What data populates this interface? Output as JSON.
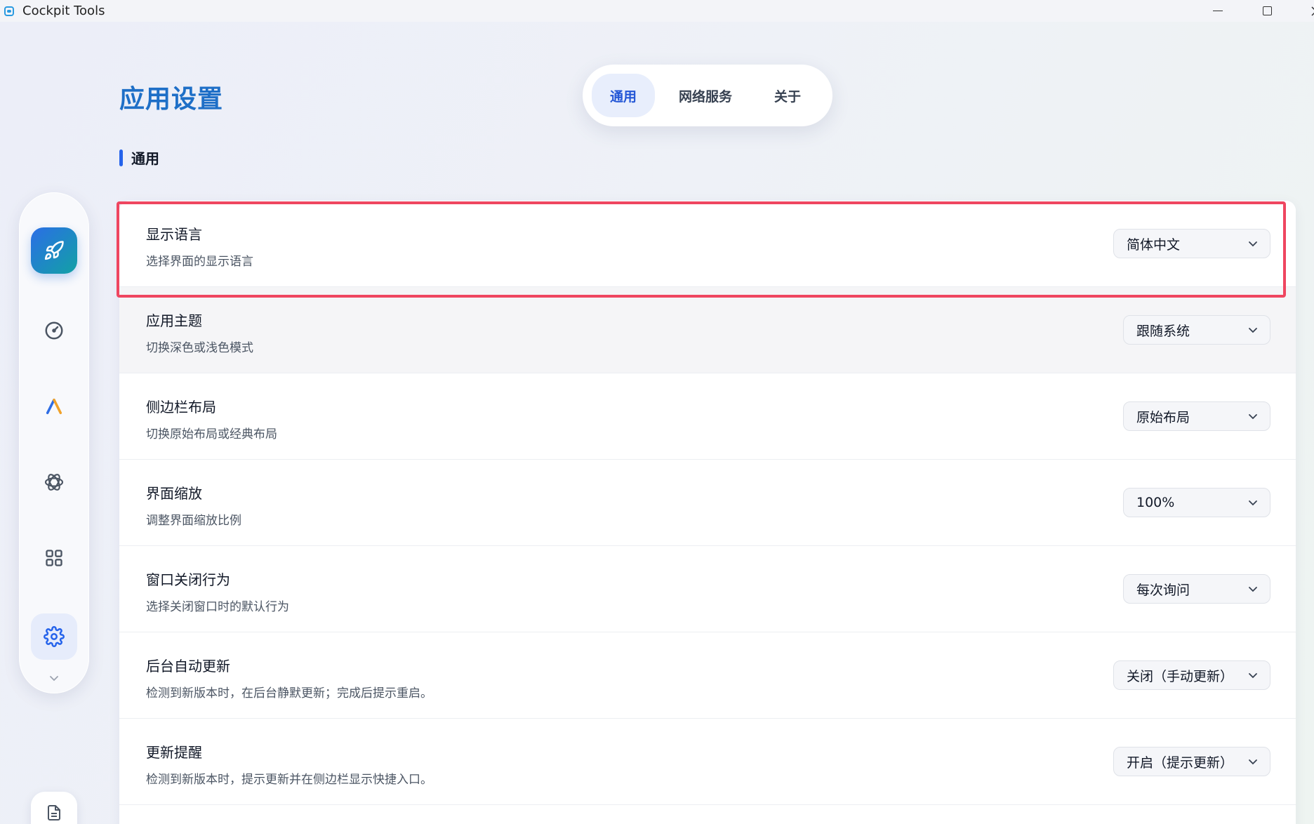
{
  "window": {
    "title": "Cockpit Tools"
  },
  "page": {
    "title": "应用设置",
    "section_title": "通用"
  },
  "tabs": [
    {
      "label": "通用",
      "active": true
    },
    {
      "label": "网络服务",
      "active": false
    },
    {
      "label": "关于",
      "active": false
    }
  ],
  "sidebar": {
    "items": [
      {
        "icon": "rocket-icon",
        "active": true
      },
      {
        "icon": "gauge-icon",
        "active": false
      },
      {
        "icon": "antigravity-logo-icon",
        "active": false
      },
      {
        "icon": "openai-logo-icon",
        "active": false
      },
      {
        "icon": "apps-grid-icon",
        "active": false
      },
      {
        "icon": "gear-icon",
        "active": true
      }
    ],
    "more_icon": "chevron-down-icon",
    "bottom_icon": "document-icon"
  },
  "settings": [
    {
      "label": "显示语言",
      "description": "选择界面的显示语言",
      "value": "简体中文"
    },
    {
      "label": "应用主题",
      "description": "切换深色或浅色模式",
      "value": "跟随系统"
    },
    {
      "label": "侧边栏布局",
      "description": "切换原始布局或经典布局",
      "value": "原始布局"
    },
    {
      "label": "界面缩放",
      "description": "调整界面缩放比例",
      "value": "100%"
    },
    {
      "label": "窗口关闭行为",
      "description": "选择关闭窗口时的默认行为",
      "value": "每次询问"
    },
    {
      "label": "后台自动更新",
      "description": "检测到新版本时，在后台静默更新；完成后提示重启。",
      "value": "关闭（手动更新）"
    },
    {
      "label": "更新提醒",
      "description": "检测到新版本时，提示更新并在侧边栏显示快捷入口。",
      "value": "开启（提示更新）"
    }
  ],
  "colors": {
    "accent": "#2563eb",
    "title": "#1e6fc7",
    "highlight_border": "#ef4660"
  }
}
